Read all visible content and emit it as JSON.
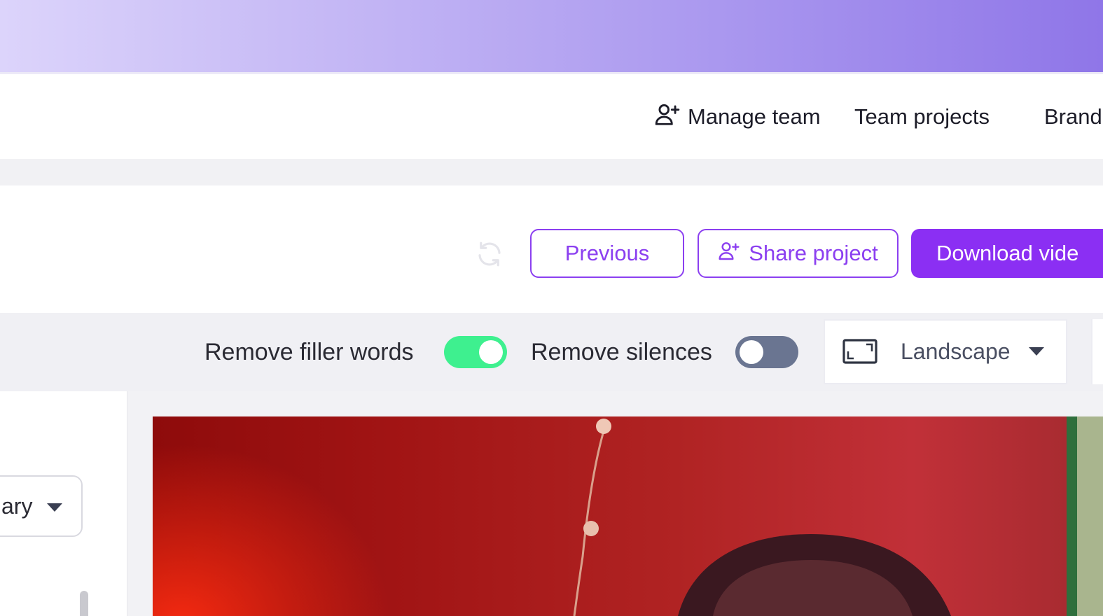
{
  "topnav": {
    "manage_team": "Manage team",
    "team_projects": "Team projects",
    "brand_partial": "Brand"
  },
  "actions": {
    "previous": "Previous",
    "share_project": "Share project",
    "download_partial": "Download vide"
  },
  "toolbar": {
    "remove_filler_words": "Remove filler words",
    "remove_filler_words_on": true,
    "remove_silences": "Remove silences",
    "remove_silences_on": false,
    "aspect_ratio": "Landscape"
  },
  "left_panel": {
    "select_partial": "ary"
  },
  "colors": {
    "accent": "#8b2ff3",
    "toggle_on": "#3ef08f",
    "toggle_off": "#6a7591"
  },
  "icons": {
    "manage_team": "user-plus-icon",
    "share_project": "user-plus-icon",
    "refresh": "refresh-icon",
    "aspect_ratio": "aspect-ratio-icon",
    "dropdown": "chevron-down-icon"
  }
}
